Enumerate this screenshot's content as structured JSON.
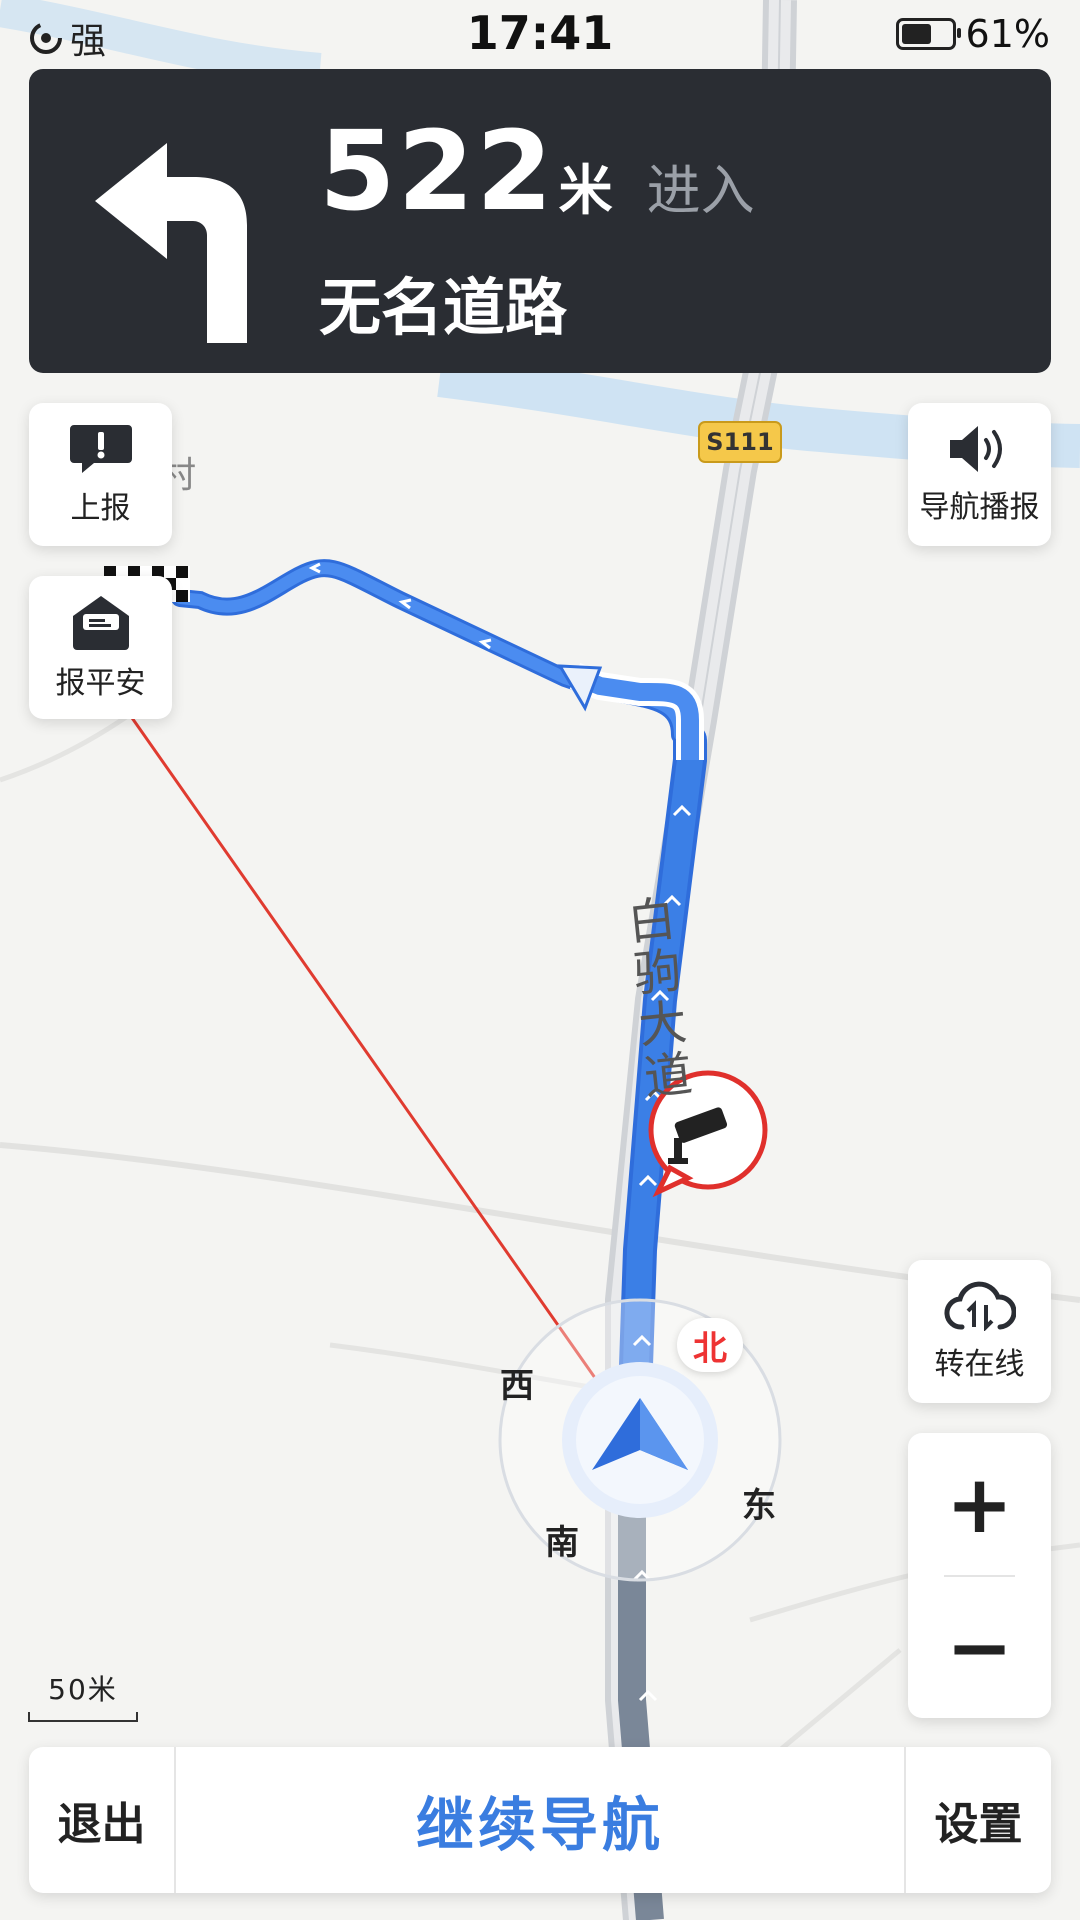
{
  "status": {
    "signal_icon": "signal-icon",
    "signal_text": "强",
    "time": "17:41",
    "battery_percent": "61%",
    "battery_level": 0.61
  },
  "guidance": {
    "turn_icon": "turn-left-arrow-icon",
    "distance": "522",
    "unit": "米",
    "action": "进入",
    "road": "无名道路"
  },
  "map": {
    "village_label": "村",
    "highway_shield": "S111",
    "road_name": "白驹大道",
    "compass": {
      "north": "北",
      "south": "南",
      "east": "东",
      "west": "西"
    },
    "scale_label": "50米",
    "route_color": "#3b7fe6",
    "camera_color": "#e0302c"
  },
  "buttons": {
    "report": "上报",
    "safe_report": "报平安",
    "voice": "导航播报",
    "online": "转在线",
    "zoom_in": "+",
    "zoom_out": "−"
  },
  "bottom": {
    "exit": "退出",
    "continue": "继续导航",
    "settings": "设置"
  }
}
